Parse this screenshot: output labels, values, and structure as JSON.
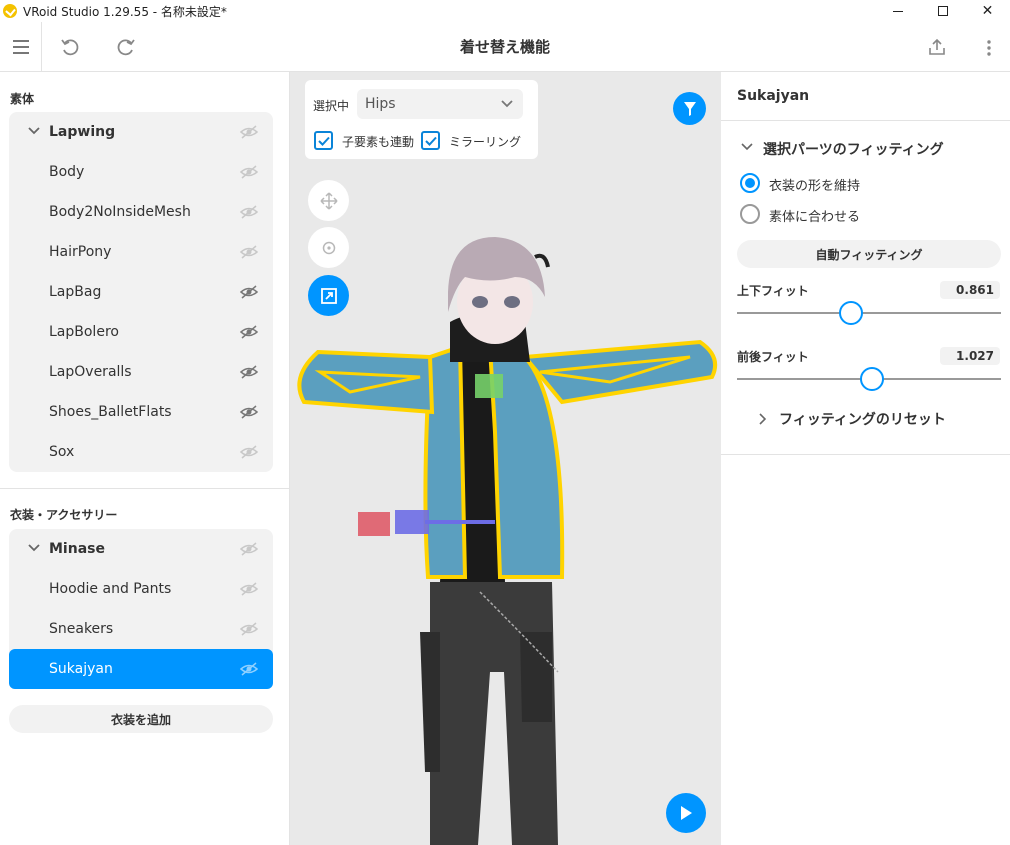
{
  "window": {
    "title": "VRoid Studio 1.29.55 - 名称未設定*"
  },
  "header": {
    "title": "着せ替え機能"
  },
  "body_section": {
    "label": "素体",
    "group": "Lapwing",
    "items": [
      "Body",
      "Body2NoInsideMesh",
      "HairPony",
      "LapBag",
      "LapBolero",
      "LapOveralls",
      "Shoes_BalletFlats",
      "Sox"
    ]
  },
  "costume_section": {
    "label": "衣装・アクセサリー",
    "group": "Minase",
    "items": [
      "Hoodie and Pants",
      "Sneakers",
      "Sukajyan"
    ],
    "selected": "Sukajyan",
    "add_button": "衣装を追加"
  },
  "viewport": {
    "select_label": "選択中",
    "selected_bone": "Hips",
    "child_link_label": "子要素も連動",
    "child_link_checked": true,
    "mirror_label": "ミラーリング",
    "mirror_checked": true,
    "active_tool": "scale"
  },
  "right_panel": {
    "title": "Sukajyan",
    "section_title": "選択パーツのフィッティング",
    "radio_options": [
      "衣装の形を維持",
      "素体に合わせる"
    ],
    "radio_selected": "衣装の形を維持",
    "auto_fit_button": "自動フィッティング",
    "vertical_fit": {
      "label": "上下フィット",
      "value": "0.861",
      "fraction": 0.43
    },
    "depth_fit": {
      "label": "前後フィット",
      "value": "1.027",
      "fraction": 0.51
    },
    "reset_label": "フィッティングのリセット"
  },
  "colors": {
    "accent": "#0095ff",
    "highlight_outline": "#ffd400",
    "jacket": "#5b9fbf"
  }
}
